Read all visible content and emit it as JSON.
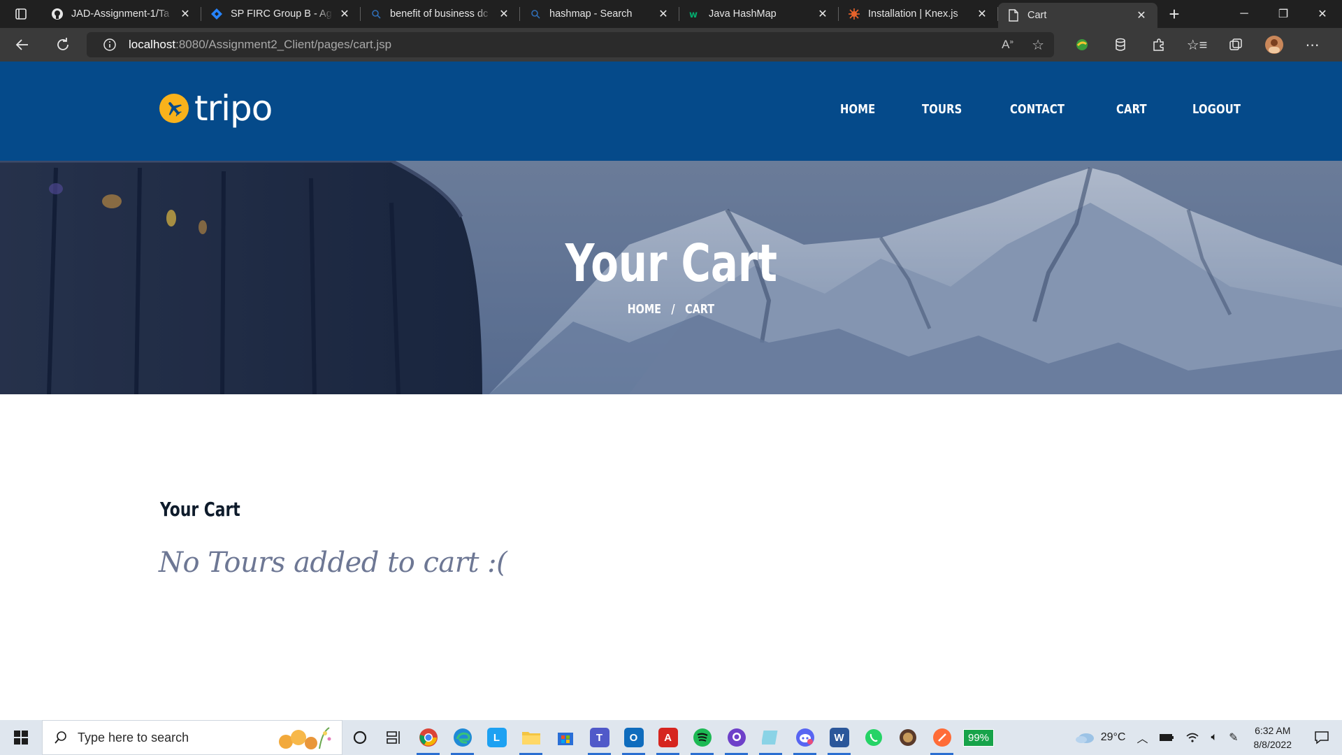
{
  "browser": {
    "tabs": [
      {
        "title": "JAD-Assignment-1/Ta",
        "icon": "github-icon"
      },
      {
        "title": "SP FIRC Group B - Ag",
        "icon": "jira-icon"
      },
      {
        "title": "benefit of business dc",
        "icon": "search-icon"
      },
      {
        "title": "hashmap - Search",
        "icon": "search-icon"
      },
      {
        "title": "Java HashMap",
        "icon": "w3schools-icon"
      },
      {
        "title": "Installation | Knex.js",
        "icon": "knex-icon"
      },
      {
        "title": "Cart",
        "icon": "page-icon"
      }
    ],
    "url_host": "localhost",
    "url_rest": ":8080/Assignment2_Client/pages/cart.jsp"
  },
  "site": {
    "logo_text": "tripo",
    "nav": [
      "HOME",
      "TOURS",
      "CONTACT",
      "CART",
      "LOGOUT"
    ]
  },
  "hero": {
    "title": "Your Cart",
    "breadcrumb": [
      "HOME",
      "CART"
    ],
    "breadcrumb_sep": "/"
  },
  "content": {
    "heading": "Your Cart",
    "empty_message": "No Tours added to cart :("
  },
  "taskbar": {
    "search_placeholder": "Type here to search",
    "battery": "99%",
    "weather": "29°C",
    "time": "6:32 AM",
    "date": "8/8/2022"
  },
  "colors": {
    "header_bg": "#054a8a",
    "logo_accent": "#f9b21b",
    "empty_text": "#6d7794"
  }
}
